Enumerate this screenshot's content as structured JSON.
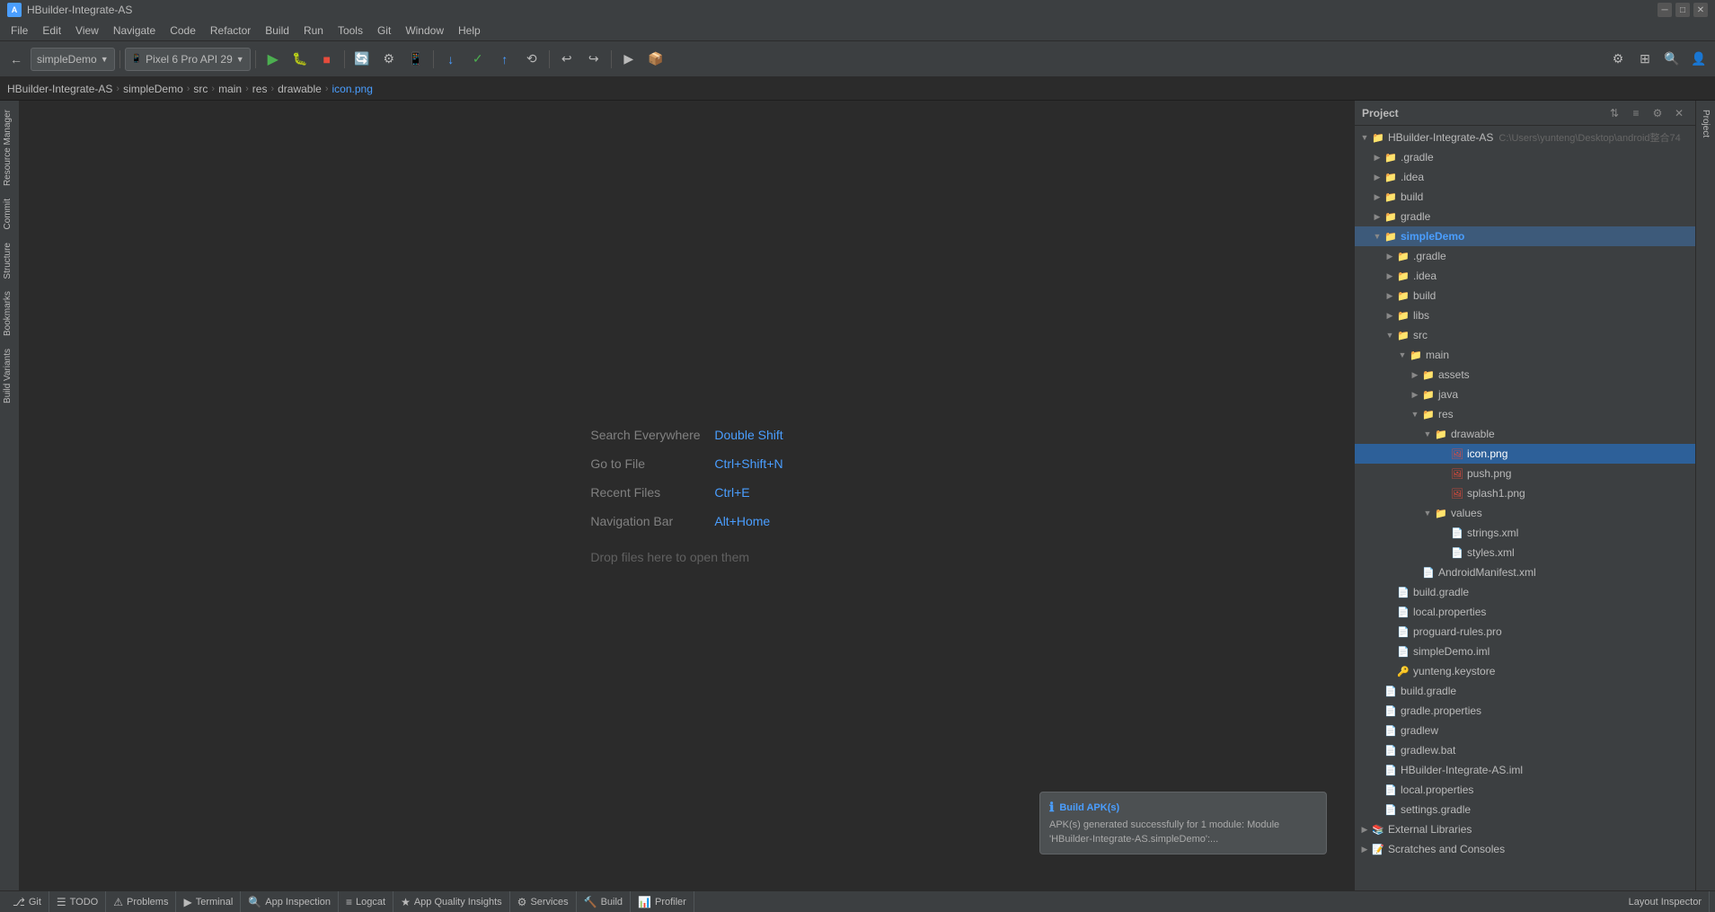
{
  "window": {
    "title": "HBuilder-Integrate-AS",
    "titlebar_title": "HBuilder-Integrate-AS"
  },
  "menu": {
    "items": [
      "File",
      "Edit",
      "View",
      "Navigate",
      "Code",
      "Refactor",
      "Build",
      "Run",
      "Tools",
      "Git",
      "Window",
      "Help"
    ]
  },
  "toolbar": {
    "project_selector": "simpleDemo",
    "device_selector": "Pixel 6 Pro API 29"
  },
  "breadcrumb": {
    "items": [
      "HBuilder-Integrate-AS",
      "simpleDemo",
      "src",
      "main",
      "res",
      "drawable",
      "icon.png"
    ]
  },
  "sidebar_tools": {
    "items": [
      "Resource Manager",
      "Commit",
      "Structure",
      "Bookmarks",
      "Build Variants"
    ]
  },
  "editor": {
    "search_everywhere_label": "Search Everywhere",
    "search_everywhere_shortcut": "Double Shift",
    "goto_file_label": "Go to File",
    "goto_file_shortcut": "Ctrl+Shift+N",
    "recent_files_label": "Recent Files",
    "recent_files_shortcut": "Ctrl+E",
    "navigation_bar_label": "Navigation Bar",
    "navigation_bar_shortcut": "Alt+Home",
    "drop_files_hint": "Drop files here to open them"
  },
  "project_panel": {
    "title": "Project",
    "root": "HBuilder-Integrate-AS",
    "root_path": "C:\\Users\\yunteng\\Desktop\\android整合74",
    "tree": [
      {
        "id": "gradle",
        "name": ".gradle",
        "type": "folder",
        "level": 1,
        "expanded": false
      },
      {
        "id": "idea",
        "name": ".idea",
        "type": "folder",
        "level": 1,
        "expanded": false
      },
      {
        "id": "build",
        "name": "build",
        "type": "folder",
        "level": 1,
        "expanded": false
      },
      {
        "id": "gradle2",
        "name": "gradle",
        "type": "folder",
        "level": 1,
        "expanded": false
      },
      {
        "id": "simpleDemo",
        "name": "simpleDemo",
        "type": "folder",
        "level": 1,
        "expanded": true,
        "highlight": true
      },
      {
        "id": "simpleDemo-gradle",
        "name": ".gradle",
        "type": "folder",
        "level": 2,
        "expanded": false
      },
      {
        "id": "simpleDemo-idea",
        "name": ".idea",
        "type": "folder",
        "level": 2,
        "expanded": false
      },
      {
        "id": "simpleDemo-build",
        "name": "build",
        "type": "folder",
        "level": 2,
        "expanded": false
      },
      {
        "id": "simpleDemo-libs",
        "name": "libs",
        "type": "folder",
        "level": 2,
        "expanded": false
      },
      {
        "id": "simpleDemo-src",
        "name": "src",
        "type": "folder",
        "level": 2,
        "expanded": true
      },
      {
        "id": "main",
        "name": "main",
        "type": "folder",
        "level": 3,
        "expanded": true
      },
      {
        "id": "assets",
        "name": "assets",
        "type": "folder",
        "level": 4,
        "expanded": false
      },
      {
        "id": "java",
        "name": "java",
        "type": "folder",
        "level": 4,
        "expanded": false
      },
      {
        "id": "res",
        "name": "res",
        "type": "folder",
        "level": 4,
        "expanded": true
      },
      {
        "id": "drawable",
        "name": "drawable",
        "type": "folder",
        "level": 5,
        "expanded": true
      },
      {
        "id": "icon.png",
        "name": "icon.png",
        "type": "png",
        "level": 6,
        "selected": true
      },
      {
        "id": "push.png",
        "name": "push.png",
        "type": "png",
        "level": 6
      },
      {
        "id": "splash1.png",
        "name": "splash1.png",
        "type": "png",
        "level": 6
      },
      {
        "id": "values",
        "name": "values",
        "type": "folder",
        "level": 5,
        "expanded": true
      },
      {
        "id": "strings.xml",
        "name": "strings.xml",
        "type": "xml",
        "level": 6
      },
      {
        "id": "styles.xml",
        "name": "styles.xml",
        "type": "xml",
        "level": 6
      },
      {
        "id": "AndroidManifest.xml",
        "name": "AndroidManifest.xml",
        "type": "xml",
        "level": 3
      },
      {
        "id": "build.gradle",
        "name": "build.gradle",
        "type": "gradle",
        "level": 2
      },
      {
        "id": "local.properties",
        "name": "local.properties",
        "type": "prop",
        "level": 2
      },
      {
        "id": "proguard-rules.pro",
        "name": "proguard-rules.pro",
        "type": "prop",
        "level": 2
      },
      {
        "id": "simpleDemo.iml",
        "name": "simpleDemo.iml",
        "type": "iml",
        "level": 2
      },
      {
        "id": "yunteng.keystore",
        "name": "yunteng.keystore",
        "type": "prop",
        "level": 2
      },
      {
        "id": "build.gradle2",
        "name": "build.gradle",
        "type": "gradle",
        "level": 1
      },
      {
        "id": "gradle.properties",
        "name": "gradle.properties",
        "type": "prop",
        "level": 1
      },
      {
        "id": "gradlew",
        "name": "gradlew",
        "type": "prop",
        "level": 1
      },
      {
        "id": "gradlew.bat",
        "name": "gradlew.bat",
        "type": "prop",
        "level": 1
      },
      {
        "id": "HBuilder.iml",
        "name": "HBuilder-Integrate-AS.iml",
        "type": "iml",
        "level": 1
      },
      {
        "id": "local.properties2",
        "name": "local.properties",
        "type": "prop",
        "level": 1
      },
      {
        "id": "settings.gradle",
        "name": "settings.gradle",
        "type": "gradle",
        "level": 1
      },
      {
        "id": "external-libraries",
        "name": "External Libraries",
        "type": "external",
        "level": 1,
        "expanded": false
      },
      {
        "id": "scratches",
        "name": "Scratches and Consoles",
        "type": "external",
        "level": 1,
        "expanded": false
      }
    ]
  },
  "notification": {
    "title": "Build APK(s)",
    "body": "APK(s) generated successfully for 1 module: Module 'HBuilder-Integrate-AS.simpleDemo':..."
  },
  "status_bar": {
    "items": [
      {
        "id": "git",
        "icon": "⎇",
        "label": "Git"
      },
      {
        "id": "todo",
        "icon": "☰",
        "label": "TODO"
      },
      {
        "id": "problems",
        "icon": "⚠",
        "label": "Problems"
      },
      {
        "id": "terminal",
        "icon": "▶",
        "label": "Terminal"
      },
      {
        "id": "app-inspection",
        "icon": "🔍",
        "label": "App Inspection"
      },
      {
        "id": "logcat",
        "icon": "≡",
        "label": "Logcat"
      },
      {
        "id": "app-quality",
        "icon": "★",
        "label": "App Quality Insights"
      },
      {
        "id": "services",
        "icon": "⚙",
        "label": "Services"
      },
      {
        "id": "build",
        "icon": "🔨",
        "label": "Build"
      },
      {
        "id": "profiler",
        "icon": "📊",
        "label": "Profiler"
      }
    ],
    "right": "Layout Inspector"
  },
  "right_edge": {
    "label": "Project"
  }
}
